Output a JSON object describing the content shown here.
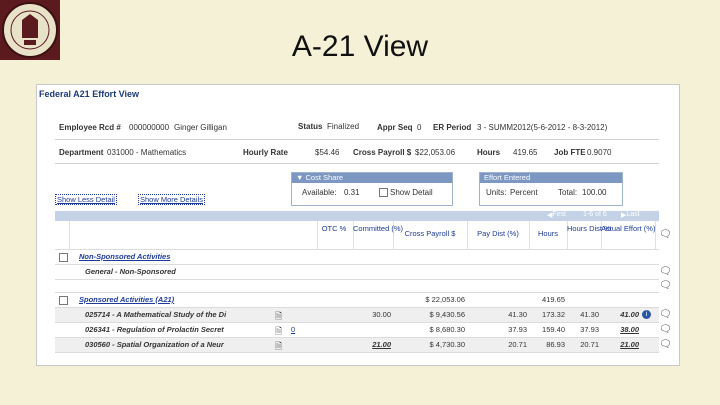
{
  "slide": {
    "title": "A-21 View"
  },
  "page": {
    "title": "Federal A21 Effort View",
    "employee": {
      "label": "Employee Rcd #",
      "id": "000000000",
      "name": "Ginger Gilligan"
    },
    "status": {
      "label": "Status",
      "value": "Finalized"
    },
    "appr_seq": {
      "label": "Appr Seq",
      "value": "0"
    },
    "er_period": {
      "label": "ER Period",
      "value": "3 - SUMM2012(5-6-2012 - 8-3-2012)"
    },
    "department": {
      "label": "Department",
      "value": "031000 - Mathematics"
    },
    "hourly_rate": {
      "label": "Hourly Rate",
      "value": "$54.46"
    },
    "cross_payroll": {
      "label": "Cross Payroll $",
      "value": "$22,053.06"
    },
    "hours": {
      "label": "Hours",
      "value": "419.65"
    },
    "job_fte": {
      "label": "Job FTE",
      "value": "0.9070"
    },
    "cost_share": {
      "header": "Cost Share",
      "available_label": "Available:",
      "available_value": "0.31",
      "show_detail": "Show Detail"
    },
    "effort_entered": {
      "header": "Effort Entered",
      "units_label": "Units:",
      "units_value": "Percent",
      "total_label": "Total:",
      "total_value": "100.00"
    },
    "show_less_detail": "Show Less Detail",
    "show_more_details": "Show More Details",
    "nav": {
      "first": "First",
      "range": "1-6 of 6",
      "last": "Last"
    },
    "columns": {
      "otc": "OTC %",
      "committed": "Committed (%)",
      "cross_payroll": "Cross Payroll $",
      "pay_dist": "Pay Dist (%)",
      "hours": "Hours",
      "hours_dist": "Hours Dist %",
      "actual_effort": "Actual Effort (%)"
    },
    "sections": {
      "non_sponsored": {
        "title": "Non-Sponsored Activities",
        "sub": "General - Non-Sponsored"
      },
      "sponsored": {
        "title": "Sponsored Activities (A21)",
        "payroll": "$ 22,053.06",
        "hours": "419.65"
      }
    },
    "rows": [
      {
        "name": "025714 - A Mathematical Study of the Di",
        "otc": "",
        "committed": "30.00",
        "payroll": "$ 9,430.56",
        "pay_dist": "41.30",
        "hours": "173.32",
        "hours_dist": "41.30",
        "effort": "41.00"
      },
      {
        "name": "026341 - Regulation of Prolactin Secret",
        "otc": "0",
        "committed": "",
        "payroll": "$ 8,680.30",
        "pay_dist": "37.93",
        "hours": "159.40",
        "hours_dist": "37.93",
        "effort": "38.00"
      },
      {
        "name": "030560 - Spatial Organization of a Neur",
        "otc": "",
        "committed": "21.00",
        "payroll": "$ 4,730.30",
        "pay_dist": "20.71",
        "hours": "86.93",
        "hours_dist": "20.71",
        "effort": "21.00"
      }
    ]
  },
  "colors": {
    "slide_bg": "#f4f1d6",
    "seal": "#5a1a1e",
    "link": "#1d3a9a",
    "header_bar": "#7b97c2"
  },
  "icons": [
    "university-seal-icon",
    "checkbox-icon",
    "document-icon",
    "info-icon",
    "comment-icon"
  ]
}
